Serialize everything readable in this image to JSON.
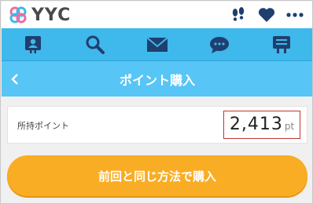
{
  "app": {
    "name": "YYC"
  },
  "header": {
    "icons": [
      "footprints-icon",
      "heart-icon",
      "more-icon"
    ]
  },
  "nav": {
    "items": [
      "profile-icon",
      "search-icon",
      "mail-icon",
      "chat-icon",
      "board-icon"
    ]
  },
  "page": {
    "title": "ポイント購入",
    "back_icon": "chevron-left-icon"
  },
  "points": {
    "label": "所持ポイント",
    "value": "2,413",
    "unit": "pt"
  },
  "action": {
    "buy_label": "前回と同じ方法で購入"
  },
  "colors": {
    "nav_bg": "#3fb8ec",
    "title_bg": "#57c5f5",
    "button_bg": "#f9ad24",
    "highlight_border": "#c0342f",
    "logo_pink": "#f06ca0",
    "logo_blue": "#3fb8ec"
  }
}
